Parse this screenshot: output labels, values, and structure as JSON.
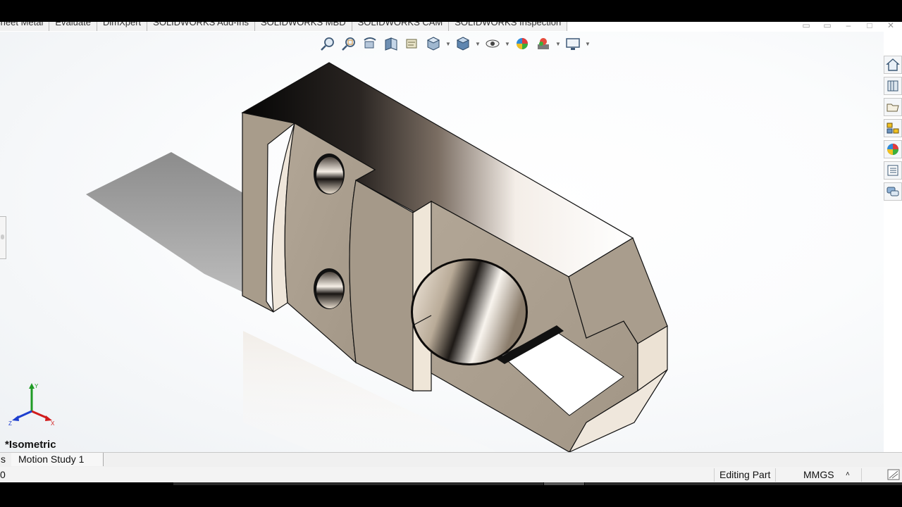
{
  "command_tabs": [
    "Sheet Metal",
    "Evaluate",
    "DimXpert",
    "SOLIDWORKS Add-Ins",
    "SOLIDWORKS MBD",
    "SOLIDWORKS CAM",
    "SOLIDWORKS Inspection"
  ],
  "heads_up_toolbar": [
    "zoom-to-fit-icon",
    "zoom-to-area-icon",
    "previous-view-icon",
    "section-view-icon",
    "dynamic-annotation-icon",
    "view-orientation-icon",
    "display-style-icon",
    "hide-show-items-icon",
    "edit-appearance-icon",
    "apply-scene-icon",
    "view-settings-icon"
  ],
  "task_pane": [
    "solidworks-resources-icon",
    "design-library-icon",
    "file-explorer-icon",
    "view-palette-icon",
    "appearances-icon",
    "custom-properties-icon",
    "forum-icon"
  ],
  "viewport": {
    "view_name": "*Isometric"
  },
  "bottom_tabs": {
    "left_fragment": "s",
    "motion_study": "Motion Study 1"
  },
  "status_bar": {
    "left_value": "0",
    "editing": "Editing Part",
    "units": "MMGS",
    "units_caret": "˄"
  },
  "colors": {
    "part_face": "#a89c8c",
    "part_light": "#e8dfd2",
    "background": "#ffffff",
    "triad_x": "#d11c1c",
    "triad_y": "#1f9b25",
    "triad_z": "#1d3fcf"
  }
}
